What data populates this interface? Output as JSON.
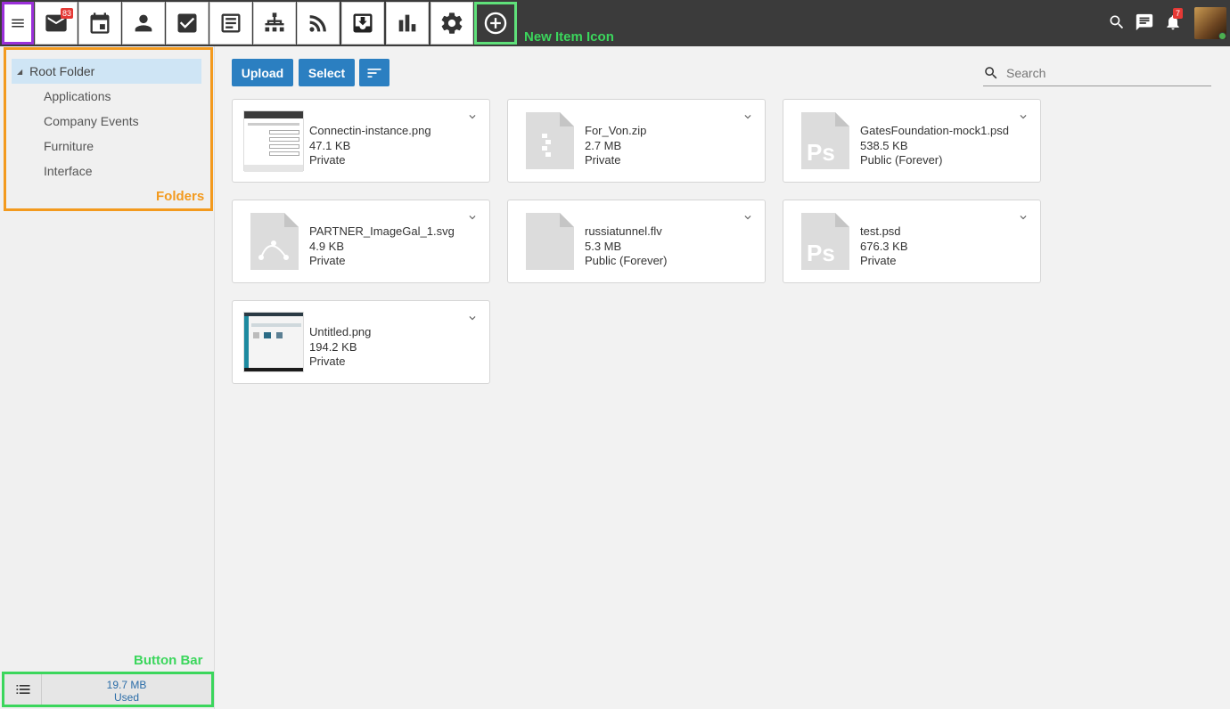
{
  "topbar": {
    "mail_badge": "83",
    "bell_badge": "7",
    "new_item_annotation": "New Item Icon"
  },
  "sidebar": {
    "root_folder": "Root Folder",
    "folders": [
      "Applications",
      "Company Events",
      "Furniture",
      "Interface"
    ],
    "folders_annotation": "Folders",
    "button_bar_annotation": "Button Bar",
    "usage": "19.7 MB",
    "usage_label": "Used"
  },
  "toolbar": {
    "upload_label": "Upload",
    "select_label": "Select",
    "search_placeholder": "Search"
  },
  "files": [
    {
      "name": "Connectin-instance.png",
      "size": "47.1 KB",
      "visibility": "Private",
      "icon": "image-thumbnail"
    },
    {
      "name": "For_Von.zip",
      "size": "2.7 MB",
      "visibility": "Private",
      "icon": "zip-file-icon"
    },
    {
      "name": "GatesFoundation-mock1.psd",
      "size": "538.5 KB",
      "visibility": "Public (Forever)",
      "icon": "psd-file-icon"
    },
    {
      "name": "PARTNER_ImageGal_1.svg",
      "size": "4.9 KB",
      "visibility": "Private",
      "icon": "svg-file-icon"
    },
    {
      "name": "russiatunnel.flv",
      "size": "5.3 MB",
      "visibility": "Public (Forever)",
      "icon": "blank-file-icon"
    },
    {
      "name": "test.psd",
      "size": "676.3 KB",
      "visibility": "Private",
      "icon": "psd-file-icon"
    },
    {
      "name": "Untitled.png",
      "size": "194.2 KB",
      "visibility": "Private",
      "icon": "image-thumbnail"
    }
  ],
  "colors": {
    "accent": "#2b7fc1",
    "topbar": "#3b3b3b",
    "annotation_green": "#3bd65c",
    "annotation_orange": "#f39a1e",
    "annotation_purple": "#9b30d9"
  }
}
